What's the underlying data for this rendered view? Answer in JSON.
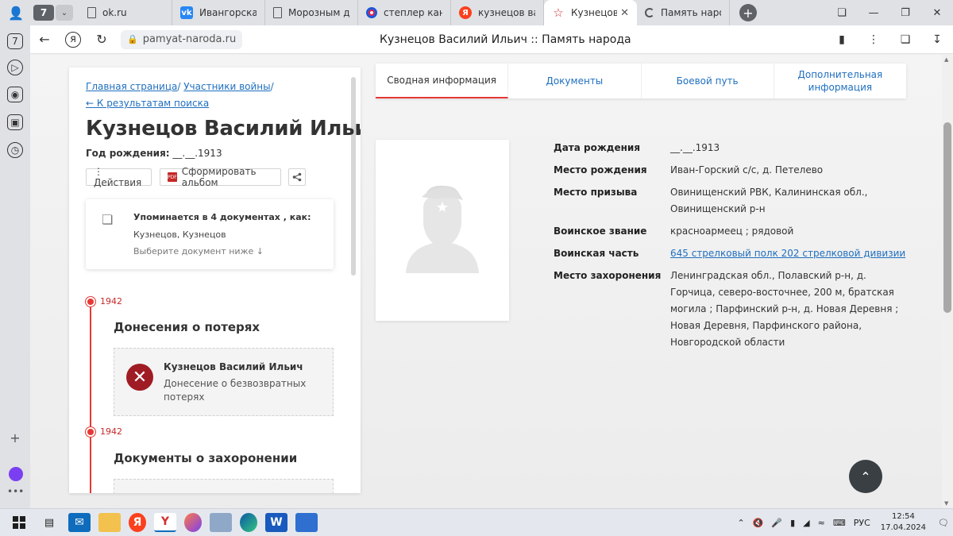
{
  "browser": {
    "tab_count": "7",
    "tabs": [
      {
        "label": "ok.ru",
        "icon": "page-icon"
      },
      {
        "label": "Ивангорская с",
        "icon": "vk-icon"
      },
      {
        "label": "Морозным дн",
        "icon": "page-icon"
      },
      {
        "label": "степлер канце",
        "icon": "ozon-icon"
      },
      {
        "label": "кузнецов васи",
        "icon": "yandex-icon"
      },
      {
        "label": "Кузнецов Ва",
        "icon": "star-icon",
        "active": true
      },
      {
        "label": "Память народ",
        "icon": "loading-icon"
      }
    ],
    "url": "pamyat-naroda.ru",
    "page_title": "Кузнецов Василий Ильич :: Память народа",
    "vsidebar_badge": "7"
  },
  "left": {
    "breadcrumb": [
      "Главная страница",
      "Участники войны"
    ],
    "back_link": "← К результатам поиска",
    "name": "Кузнецов Василий Ильич",
    "birth_label": "Год рождения:",
    "birth_value": "__.__.1913",
    "actions_button": "⋮ Действия",
    "album_button": "Сформировать альбом",
    "mention": {
      "title": "Упоминается в 4 документах , как:",
      "names": "Кузнецов, Кузнецов",
      "hint": "Выберите документ ниже ↓"
    },
    "timeline": [
      {
        "year": "1942",
        "section": "Донесения о потерях"
      },
      {
        "year": "1942",
        "section": "Документы о захоронении"
      }
    ],
    "report": {
      "name": "Кузнецов Василий Ильич",
      "desc": "Донесение о безвозвратных потерях"
    }
  },
  "tabs": [
    "Сводная информация",
    "Документы",
    "Боевой путь",
    "Дополнительная информация"
  ],
  "info": [
    {
      "label": "Дата рождения",
      "value": "__.__.1913"
    },
    {
      "label": "Место рождения",
      "value": "Иван-Горский с/с, д. Петелево"
    },
    {
      "label": "Место призыва",
      "value": "Овинищенский РВК, Калининская обл., Овинищенский р-н"
    },
    {
      "label": "Воинское звание",
      "value": "красноармеец ; рядовой"
    },
    {
      "label": "Воинская часть",
      "value": "645 стрелковый полк 202 стрелковой дивизии",
      "link": true
    },
    {
      "label": "Место захоронения",
      "value": "Ленинградская обл., Полавский р-н, д. Горчица, северо-восточнее, 200 м, братская могила ; Парфинский р-н, д. Новая Деревня ; Новая Деревня, Парфинского района, Новгородской области"
    }
  ],
  "taskbar": {
    "language": "РУС",
    "time": "12:54",
    "date": "17.04.2024"
  },
  "colors": {
    "accent_red": "#e53935",
    "link_blue": "#1f6fbf",
    "loss_icon": "#a01c24"
  }
}
